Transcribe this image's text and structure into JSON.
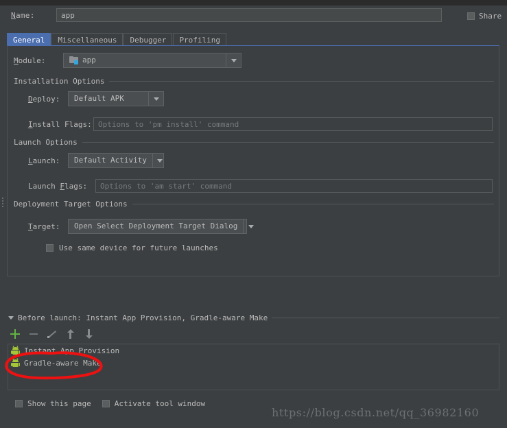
{
  "dialog": {
    "name_label": "Name:",
    "name_value": "app",
    "share_label": "Share",
    "share_checked": false
  },
  "tabs": [
    {
      "label": "General",
      "active": true
    },
    {
      "label": "Miscellaneous",
      "active": false
    },
    {
      "label": "Debugger",
      "active": false
    },
    {
      "label": "Profiling",
      "active": false
    }
  ],
  "general": {
    "module": {
      "label": "Module:",
      "value": "app",
      "icon": "module-folder-icon"
    },
    "installation": {
      "title": "Installation Options",
      "deploy": {
        "label": "Deploy:",
        "value": "Default APK"
      },
      "install_flags": {
        "label": "Install Flags:",
        "value": "",
        "placeholder": "Options to 'pm install' command"
      }
    },
    "launch": {
      "title": "Launch Options",
      "launch": {
        "label": "Launch:",
        "value": "Default Activity"
      },
      "launch_flags": {
        "label": "Launch Flags:",
        "value": "",
        "placeholder": "Options to 'am start' command"
      }
    },
    "deployment": {
      "title": "Deployment Target Options",
      "target": {
        "label": "Target:",
        "value": "Open Select Deployment Target Dialog"
      },
      "same_device": {
        "label": "Use same device for future launches",
        "checked": false
      }
    }
  },
  "before_launch": {
    "header": "Before launch: Instant App Provision, Gradle-aware Make",
    "toolbar": [
      {
        "name": "add-button",
        "glyph": "plus"
      },
      {
        "name": "remove-button",
        "glyph": "minus"
      },
      {
        "name": "edit-button",
        "glyph": "pencil"
      },
      {
        "name": "move-up-button",
        "glyph": "arrow-up"
      },
      {
        "name": "move-down-button",
        "glyph": "arrow-down"
      }
    ],
    "items": [
      {
        "label": "Instant App Provision",
        "icon": "android-icon"
      },
      {
        "label": "Gradle-aware Make",
        "icon": "android-icon"
      }
    ]
  },
  "bottom": {
    "show_page": {
      "label": "Show this page",
      "checked": false
    },
    "activate_tool_window": {
      "label": "Activate tool window",
      "checked": false
    }
  },
  "watermark": "https://blog.csdn.net/qq_36982160",
  "colors": {
    "background": "#3c3f41",
    "accent": "#4b6eaf",
    "android_green": "#a4c639",
    "add_green": "#62b543",
    "annotation_red": "#ee1111",
    "text": "#bbbbbb",
    "placeholder": "#777b7d"
  }
}
